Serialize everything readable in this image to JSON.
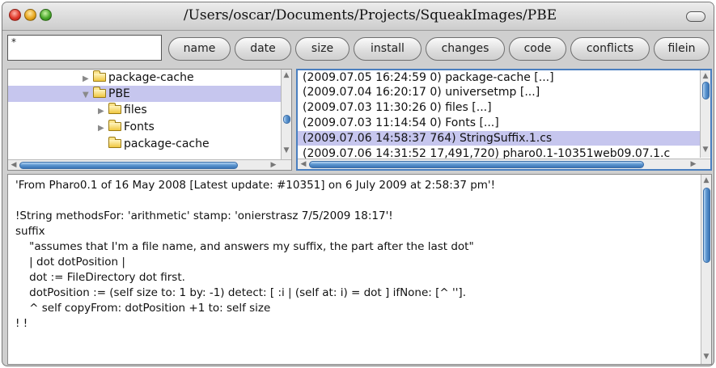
{
  "window": {
    "title": "/Users/oscar/Documents/Projects/SqueakImages/PBE"
  },
  "pattern": {
    "value": "*"
  },
  "buttons": [
    "name",
    "date",
    "size",
    "install",
    "changes",
    "code",
    "conflicts",
    "filein"
  ],
  "tree": {
    "items": [
      {
        "label": "package-cache",
        "expand": "▶",
        "selected": false
      },
      {
        "label": "PBE",
        "expand": "▼",
        "selected": true
      },
      {
        "label": "files",
        "expand": "▶",
        "selected": false
      },
      {
        "label": "Fonts",
        "expand": "▶",
        "selected": false
      },
      {
        "label": "package-cache",
        "expand": "",
        "selected": false
      }
    ]
  },
  "files": {
    "items": [
      "(2009.07.05 16:24:59 0) package-cache [...]",
      "(2009.07.04 16:20:17 0) universetmp [...]",
      "(2009.07.03 11:30:26 0) files [...]",
      "(2009.07.03 11:14:54 0) Fonts [...]",
      "(2009.07.06 14:58:37 764) StringSuffix.1.cs",
      "(2009.07.06 14:31:52 17,491,720) pharo0.1-10351web09.07.1.c"
    ],
    "selected_index": 4
  },
  "code": {
    "lines": [
      "'From Pharo0.1 of 16 May 2008 [Latest update: #10351] on 6 July 2009 at 2:58:37 pm'!",
      "",
      "!String methodsFor: 'arithmetic' stamp: 'onierstrasz 7/5/2009 18:17'!",
      "suffix",
      "    \"assumes that I'm a file name, and answers my suffix, the part after the last dot\"",
      "    | dot dotPosition |",
      "    dot := FileDirectory dot first.",
      "    dotPosition := (self size to: 1 by: -1) detect: [ :i | (self at: i) = dot ] ifNone: [^ ''].",
      "    ^ self copyFrom: dotPosition +1 to: self size",
      "! !"
    ]
  },
  "icons": [
    "close-icon",
    "minimize-icon",
    "zoom-icon",
    "folder-icon",
    "triangle-right-icon",
    "triangle-down-icon",
    "scroll-up-icon",
    "scroll-down-icon",
    "scroll-left-icon",
    "scroll-right-icon",
    "collapse-pill-icon"
  ],
  "colors": {
    "selection": "#c6c6ee",
    "focus_border": "#4a7fbf",
    "scroll_thumb": "#5d97d1"
  }
}
